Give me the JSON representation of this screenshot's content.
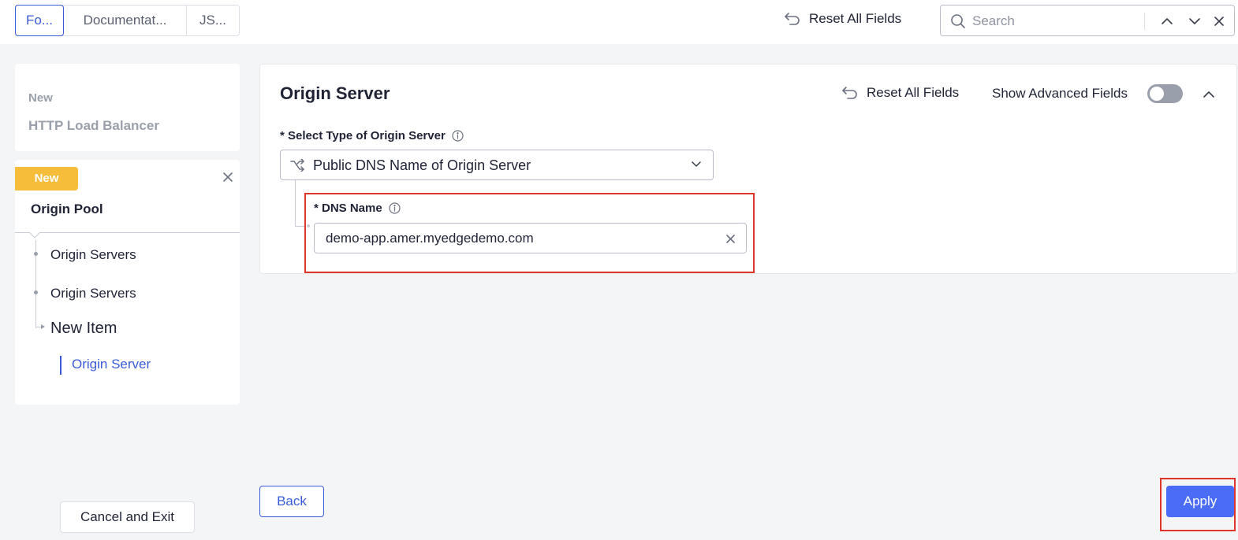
{
  "tabs": [
    {
      "label": "Fo...",
      "active": true
    },
    {
      "label": "Documentat...",
      "active": false
    },
    {
      "label": "JS...",
      "active": false
    }
  ],
  "top": {
    "reset_label": "Reset All Fields",
    "search_placeholder": "Search"
  },
  "sidebar": {
    "parent_badge": "New",
    "parent_title": "HTTP Load Balancer",
    "child_badge": "New",
    "child_title": "Origin Pool",
    "items": [
      {
        "label": "Origin Servers"
      },
      {
        "label": "Origin Servers"
      },
      {
        "label": "New Item"
      },
      {
        "label": "Origin Server",
        "active": true
      }
    ],
    "cancel_label": "Cancel and Exit"
  },
  "panel": {
    "title": "Origin Server",
    "reset_label": "Reset All Fields",
    "advanced_label": "Show Advanced Fields",
    "advanced_enabled": false,
    "origin_type_label": "* Select Type of Origin Server",
    "origin_type_value": "Public DNS Name of Origin Server",
    "dns_label": "* DNS Name",
    "dns_value": "demo-app.amer.myedgedemo.com"
  },
  "footer": {
    "back_label": "Back",
    "apply_label": "Apply"
  },
  "colors": {
    "accent": "#3a5bd9",
    "apply": "#4a6cf7",
    "badge": "#f6bd3a",
    "highlight": "#e0352b"
  }
}
